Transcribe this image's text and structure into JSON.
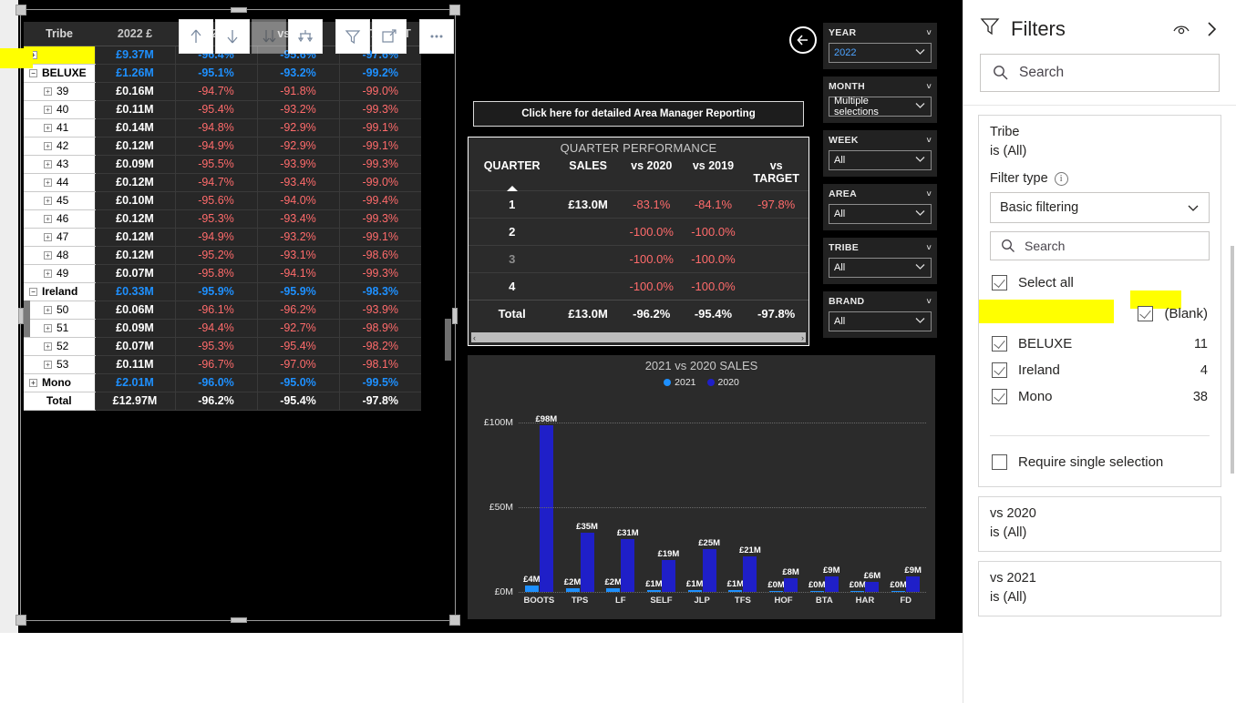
{
  "matrix": {
    "headers": [
      "Tribe",
      "2022 £",
      "vs 2021",
      "vs 2020",
      "vs TARGET"
    ],
    "rows": [
      {
        "label": "",
        "level": 0,
        "expander": "plus",
        "highlight": true,
        "values": [
          "£9.37M",
          "-96.4%",
          "-95.6%",
          "-97.6%"
        ],
        "style": "blue"
      },
      {
        "label": "BELUXE",
        "level": 0,
        "expander": "minus",
        "values": [
          "£1.26M",
          "-95.1%",
          "-93.2%",
          "-99.2%"
        ],
        "style": "blue"
      },
      {
        "label": "39",
        "level": 1,
        "expander": "plus",
        "values": [
          "£0.16M",
          "-94.7%",
          "-91.8%",
          "-99.0%"
        ],
        "style": "red"
      },
      {
        "label": "40",
        "level": 1,
        "expander": "plus",
        "values": [
          "£0.11M",
          "-95.4%",
          "-93.2%",
          "-99.3%"
        ],
        "style": "red"
      },
      {
        "label": "41",
        "level": 1,
        "expander": "plus",
        "values": [
          "£0.14M",
          "-94.8%",
          "-92.9%",
          "-99.1%"
        ],
        "style": "red"
      },
      {
        "label": "42",
        "level": 1,
        "expander": "plus",
        "values": [
          "£0.12M",
          "-94.9%",
          "-92.9%",
          "-99.1%"
        ],
        "style": "red"
      },
      {
        "label": "43",
        "level": 1,
        "expander": "plus",
        "values": [
          "£0.09M",
          "-95.5%",
          "-93.9%",
          "-99.3%"
        ],
        "style": "red"
      },
      {
        "label": "44",
        "level": 1,
        "expander": "plus",
        "values": [
          "£0.12M",
          "-94.7%",
          "-93.4%",
          "-99.0%"
        ],
        "style": "red"
      },
      {
        "label": "45",
        "level": 1,
        "expander": "plus",
        "values": [
          "£0.10M",
          "-95.6%",
          "-94.0%",
          "-99.4%"
        ],
        "style": "red"
      },
      {
        "label": "46",
        "level": 1,
        "expander": "plus",
        "values": [
          "£0.12M",
          "-95.3%",
          "-93.4%",
          "-99.3%"
        ],
        "style": "red"
      },
      {
        "label": "47",
        "level": 1,
        "expander": "plus",
        "values": [
          "£0.12M",
          "-94.9%",
          "-93.2%",
          "-99.1%"
        ],
        "style": "red"
      },
      {
        "label": "48",
        "level": 1,
        "expander": "plus",
        "values": [
          "£0.12M",
          "-95.2%",
          "-93.1%",
          "-98.6%"
        ],
        "style": "red"
      },
      {
        "label": "49",
        "level": 1,
        "expander": "plus",
        "values": [
          "£0.07M",
          "-95.8%",
          "-94.1%",
          "-99.3%"
        ],
        "style": "red"
      },
      {
        "label": "Ireland",
        "level": 0,
        "expander": "minus",
        "values": [
          "£0.33M",
          "-95.9%",
          "-95.9%",
          "-98.3%"
        ],
        "style": "blue"
      },
      {
        "label": "50",
        "level": 1,
        "expander": "plus",
        "values": [
          "£0.06M",
          "-96.1%",
          "-96.2%",
          "-93.9%"
        ],
        "style": "red"
      },
      {
        "label": "51",
        "level": 1,
        "expander": "plus",
        "values": [
          "£0.09M",
          "-94.4%",
          "-92.7%",
          "-98.9%"
        ],
        "style": "red"
      },
      {
        "label": "52",
        "level": 1,
        "expander": "plus",
        "values": [
          "£0.07M",
          "-95.3%",
          "-95.4%",
          "-98.2%"
        ],
        "style": "red"
      },
      {
        "label": "53",
        "level": 1,
        "expander": "plus",
        "values": [
          "£0.11M",
          "-96.7%",
          "-97.0%",
          "-98.1%"
        ],
        "style": "red"
      },
      {
        "label": "Mono",
        "level": 0,
        "expander": "plus",
        "values": [
          "£2.01M",
          "-96.0%",
          "-95.0%",
          "-99.5%"
        ],
        "style": "blue"
      },
      {
        "label": "Total",
        "level": 0,
        "expander": "none",
        "total": true,
        "values": [
          "£12.97M",
          "-96.2%",
          "-95.4%",
          "-97.8%"
        ],
        "style": "white"
      }
    ],
    "toolbar": [
      {
        "name": "drill-up-icon",
        "glyph": "up-arrow",
        "disabled": false
      },
      {
        "name": "drill-down-icon",
        "glyph": "down-arrow",
        "disabled": false
      },
      {
        "name": "expand-all-icon",
        "glyph": "double-down-arrow",
        "disabled": true
      },
      {
        "name": "drill-next-level-icon",
        "glyph": "split-down-arrow",
        "disabled": false
      },
      {
        "name": "filter-icon",
        "glyph": "funnel",
        "disabled": false
      },
      {
        "name": "focus-mode-icon",
        "glyph": "expand-frame",
        "disabled": false
      },
      {
        "name": "more-options-icon",
        "glyph": "ellipsis",
        "disabled": false
      }
    ]
  },
  "cta": {
    "label": "Click here for detailed Area Manager Reporting"
  },
  "quarter": {
    "title": "QUARTER PERFORMANCE",
    "headers": [
      "QUARTER",
      "SALES",
      "vs 2020",
      "vs 2019",
      "vs TARGET"
    ],
    "rows": [
      {
        "quarter": "1",
        "sales": "£13.0M",
        "vs2020": "-83.1%",
        "vs2019": "-84.1%",
        "vsTarget": "-97.8%"
      },
      {
        "quarter": "2",
        "sales": "",
        "vs2020": "-100.0%",
        "vs2019": "-100.0%",
        "vsTarget": ""
      },
      {
        "quarter": "3",
        "sales": "",
        "vs2020": "-100.0%",
        "vs2019": "-100.0%",
        "vsTarget": ""
      },
      {
        "quarter": "4",
        "sales": "",
        "vs2020": "-100.0%",
        "vs2019": "-100.0%",
        "vsTarget": ""
      }
    ],
    "total": {
      "quarter": "Total",
      "sales": "£13.0M",
      "vs2020": "-96.2%",
      "vs2019": "-95.4%",
      "vsTarget": "-97.8%"
    }
  },
  "chart_data": {
    "type": "bar",
    "title": "2021 vs 2020 SALES",
    "xlabel": "",
    "ylabel": "",
    "ylim": [
      0,
      110
    ],
    "yticks": [
      0,
      50,
      100
    ],
    "ytick_labels": [
      "£0M",
      "£50M",
      "£100M"
    ],
    "grid": true,
    "legend_position": "top",
    "categories": [
      "BOOTS",
      "TPS",
      "LF",
      "SELF",
      "JLP",
      "TFS",
      "HOF",
      "BTA",
      "HAR",
      "FD"
    ],
    "series": [
      {
        "name": "2021",
        "color": "#1e90ff",
        "values": [
          4,
          2,
          2,
          1,
          1,
          1,
          0,
          0,
          0,
          0
        ],
        "labels": [
          "£4M",
          "£2M",
          "£2M",
          "£1M",
          "£1M",
          "£1M",
          "£0M",
          "£0M",
          "£0M",
          "£0M"
        ]
      },
      {
        "name": "2020",
        "color": "#1f1fc8",
        "values": [
          98,
          35,
          31,
          19,
          25,
          21,
          8,
          9,
          6,
          9
        ],
        "labels": [
          "£98M",
          "£35M",
          "£31M",
          "£19M",
          "£25M",
          "£21M",
          "£8M",
          "£9M",
          "£6M",
          "£9M"
        ]
      }
    ]
  },
  "slicers": [
    {
      "title": "YEAR",
      "value": "2022",
      "accent": true
    },
    {
      "title": "MONTH",
      "value": "Multiple selections",
      "accent": false
    },
    {
      "title": "WEEK",
      "value": "All",
      "accent": false
    },
    {
      "title": "AREA",
      "value": "All",
      "accent": false
    },
    {
      "title": "TRIBE",
      "value": "All",
      "accent": false
    },
    {
      "title": "BRAND",
      "value": "All",
      "accent": false
    }
  ],
  "filters": {
    "title": "Filters",
    "search_placeholder": "Search",
    "active_card": {
      "field": "Tribe",
      "condition": "is (All)",
      "filter_type_label": "Filter type",
      "filter_type_value": "Basic filtering",
      "item_search_placeholder": "Search",
      "items": [
        {
          "label": "Select all",
          "checked": true,
          "count": ""
        },
        {
          "label": "(Blank)",
          "checked": true,
          "count": "",
          "highlighted": true
        },
        {
          "label": "BELUXE",
          "checked": true,
          "count": "11"
        },
        {
          "label": "Ireland",
          "checked": true,
          "count": "4"
        },
        {
          "label": "Mono",
          "checked": true,
          "count": "38"
        }
      ],
      "require_single_selection": {
        "label": "Require single selection",
        "checked": false
      }
    },
    "other_cards": [
      {
        "field": "vs 2020",
        "condition": "is (All)"
      },
      {
        "field": "vs 2021",
        "condition": "is (All)"
      }
    ]
  }
}
